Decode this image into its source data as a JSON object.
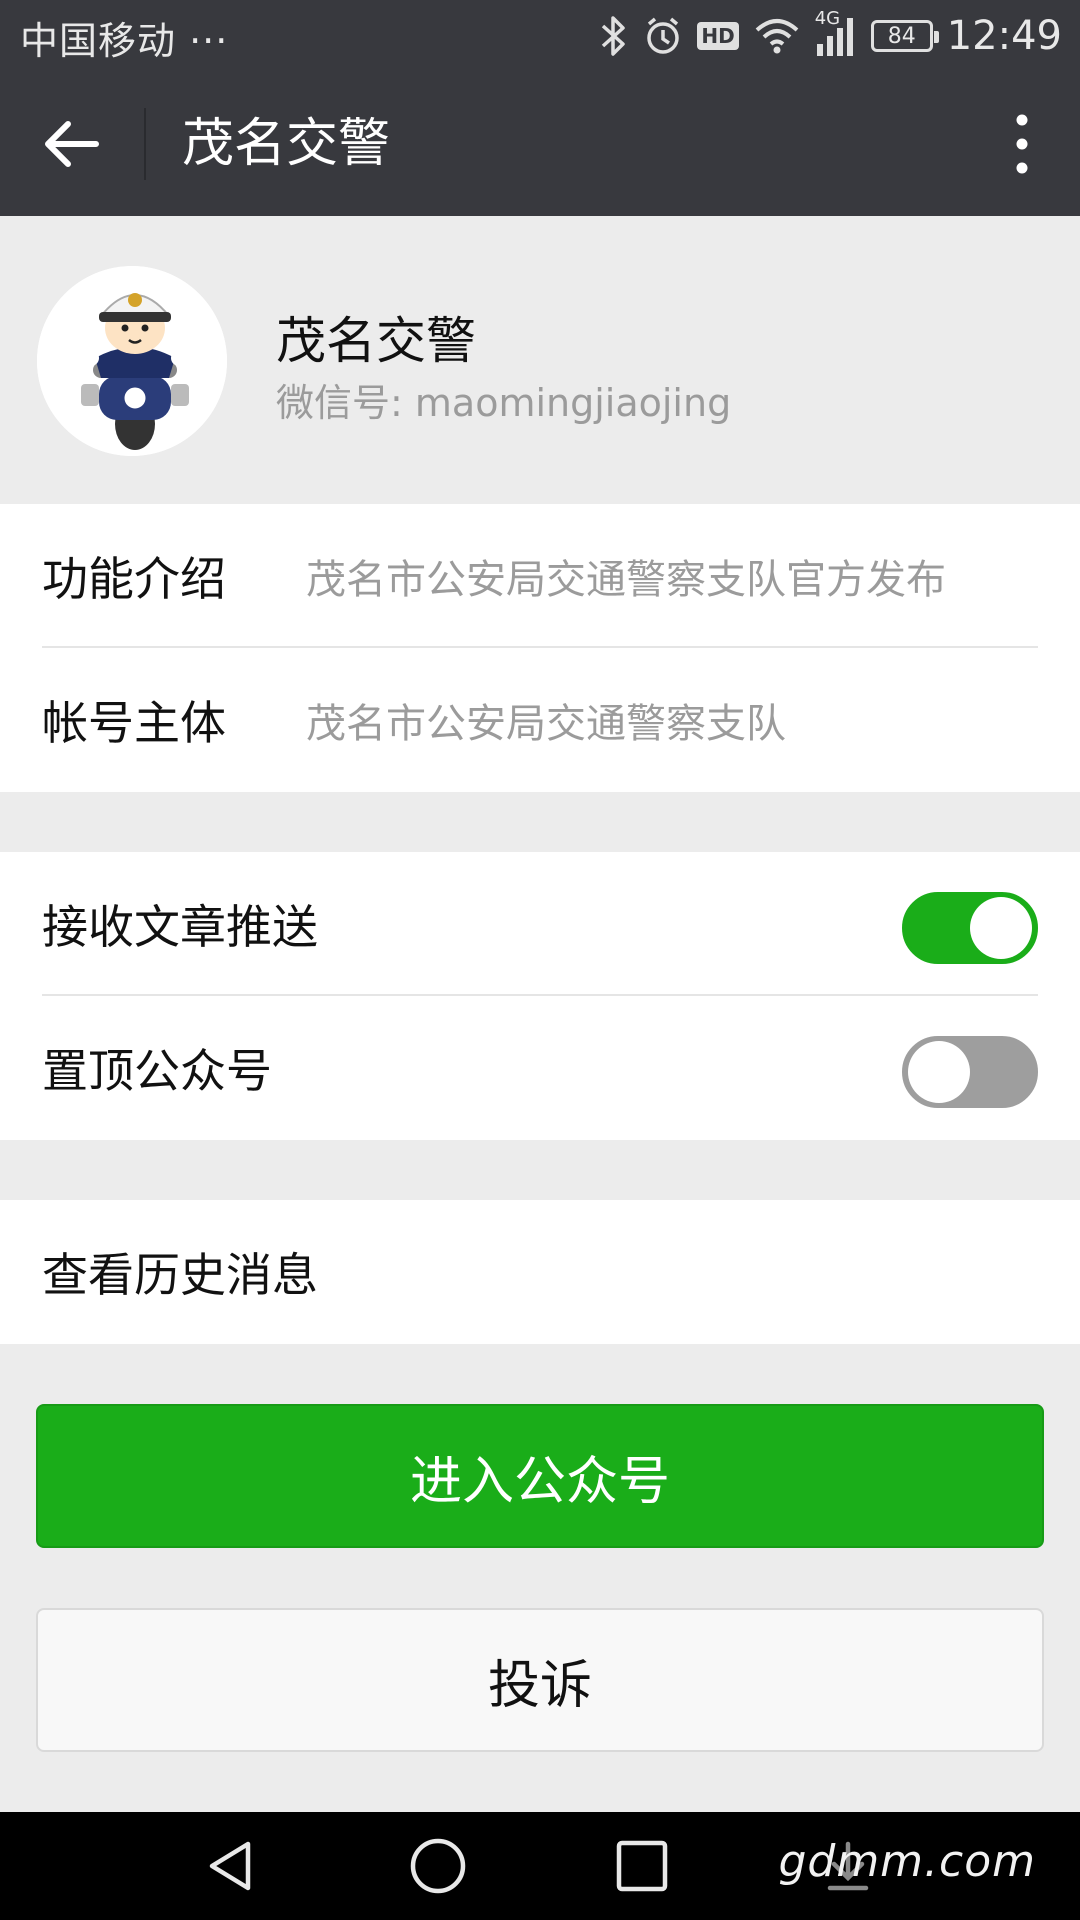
{
  "status_bar": {
    "carrier": "中国移动 ···",
    "network_badge": "HD",
    "network_type": "4G",
    "battery": "84",
    "time": "12:49",
    "icons": [
      "bluetooth-icon",
      "alarm-icon",
      "hd-icon",
      "wifi-icon",
      "signal-icon",
      "battery-icon"
    ]
  },
  "header": {
    "title": "茂名交警",
    "back_icon": "back-arrow-icon",
    "more_icon": "more-vertical-icon"
  },
  "profile": {
    "name": "茂名交警",
    "wechat_id_label": "微信号: ",
    "wechat_id": "maomingjiaojing",
    "avatar": "traffic-police-cartoon-avatar"
  },
  "info": {
    "rows": [
      {
        "label": "功能介绍",
        "value": "茂名市公安局交通警察支队官方发布"
      },
      {
        "label": "帐号主体",
        "value": "茂名市公安局交通警察支队"
      }
    ]
  },
  "settings": {
    "rows": [
      {
        "label": "接收文章推送",
        "enabled": true
      },
      {
        "label": "置顶公众号",
        "enabled": false
      }
    ]
  },
  "history": {
    "label": "查看历史消息"
  },
  "buttons": {
    "enter": "进入公众号",
    "complain": "投诉"
  },
  "nav_bar": {
    "icons": [
      "nav-back-icon",
      "nav-home-icon",
      "nav-recents-icon",
      "nav-download-icon"
    ]
  },
  "watermark": "gdmm.com",
  "colors": {
    "bar_bg": "#38393e",
    "page_bg": "#ececec",
    "accent_green": "#1aad19",
    "toggle_off": "#9e9e9e",
    "secondary_text": "#9b9b9b"
  }
}
